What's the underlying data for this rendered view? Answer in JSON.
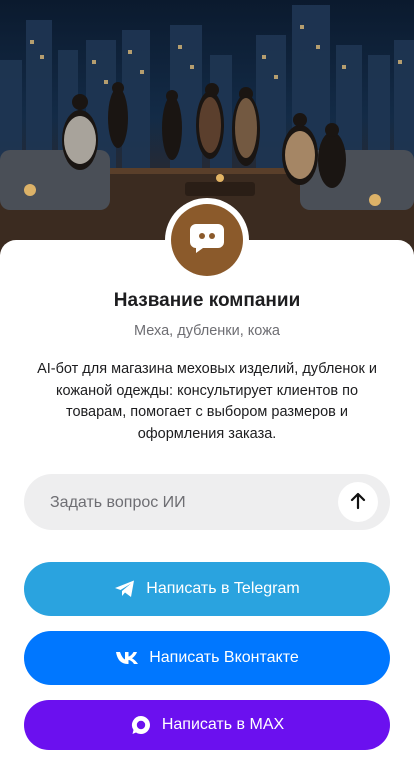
{
  "hero": {
    "icon": "rooftop-lounge-image"
  },
  "profile": {
    "avatar_icon": "chat-bubble-icon",
    "avatar_color": "#8b5a2b",
    "company_name": "Название компании",
    "tagline": "Меха, дубленки, кожа",
    "description": "AI-бот для магазина меховых изделий, дубленок и кожаной одежды: консультирует клиентов по товарам, помогает с выбором размеров и оформления заказа."
  },
  "ask": {
    "placeholder": "Задать вопрос ИИ",
    "send_icon": "arrow-up-icon"
  },
  "actions": {
    "telegram": {
      "label": "Написать в Telegram",
      "icon": "telegram-icon",
      "color": "#2aa3df"
    },
    "vk": {
      "label": "Написать Вконтакте",
      "icon": "vk-icon",
      "color": "#0077ff"
    },
    "max": {
      "label": "Написать в MAX",
      "icon": "max-icon",
      "color": "#6b10ef"
    }
  }
}
